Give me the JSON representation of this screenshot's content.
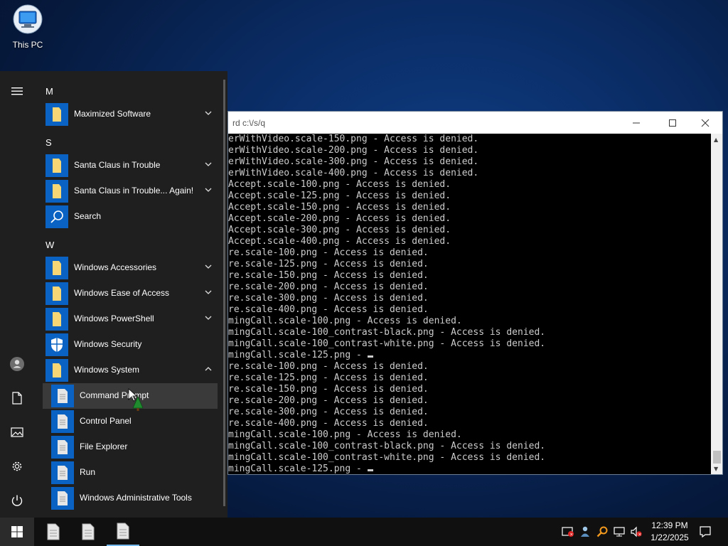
{
  "desktop": {
    "icons": [
      {
        "label": "This PC",
        "icon": "this-pc-icon"
      }
    ]
  },
  "console": {
    "title": "rd  c:\\/s/q",
    "lines": [
      "erWithVideo.scale-150.png - Access is denied.",
      "erWithVideo.scale-200.png - Access is denied.",
      "erWithVideo.scale-300.png - Access is denied.",
      "erWithVideo.scale-400.png - Access is denied.",
      "Accept.scale-100.png - Access is denied.",
      "Accept.scale-125.png - Access is denied.",
      "Accept.scale-150.png - Access is denied.",
      "Accept.scale-200.png - Access is denied.",
      "Accept.scale-300.png - Access is denied.",
      "Accept.scale-400.png - Access is denied.",
      "re.scale-100.png - Access is denied.",
      "re.scale-125.png - Access is denied.",
      "re.scale-150.png - Access is denied.",
      "re.scale-200.png - Access is denied.",
      "re.scale-300.png - Access is denied.",
      "re.scale-400.png - Access is denied.",
      "mingCall.scale-100.png - Access is denied.",
      "mingCall.scale-100_contrast-black.png - Access is denied.",
      "mingCall.scale-100_contrast-white.png - Access is denied.",
      "mingCall.scale-125.png - ",
      "re.scale-100.png - Access is denied.",
      "re.scale-125.png - Access is denied.",
      "re.scale-150.png - Access is denied.",
      "re.scale-200.png - Access is denied.",
      "re.scale-300.png - Access is denied.",
      "re.scale-400.png - Access is denied.",
      "mingCall.scale-100.png - Access is denied.",
      "mingCall.scale-100_contrast-black.png - Access is denied.",
      "mingCall.scale-100_contrast-white.png - Access is denied.",
      "mingCall.scale-125.png - "
    ],
    "cursor_lines": [
      19,
      29
    ]
  },
  "start_menu": {
    "groups": [
      {
        "letter": "M",
        "apps": [
          {
            "name": "Maximized Software",
            "icon": "folder-icon",
            "expandable": true,
            "expanded": false
          }
        ]
      },
      {
        "letter": "S",
        "apps": [
          {
            "name": "Santa Claus in Trouble",
            "icon": "folder-icon",
            "expandable": true,
            "expanded": false
          },
          {
            "name": "Santa Claus in Trouble... Again!",
            "icon": "folder-icon",
            "expandable": true,
            "expanded": false
          },
          {
            "name": "Search",
            "icon": "search-icon",
            "expandable": false
          }
        ]
      },
      {
        "letter": "W",
        "apps": [
          {
            "name": "Windows Accessories",
            "icon": "folder-icon",
            "expandable": true,
            "expanded": false
          },
          {
            "name": "Windows Ease of Access",
            "icon": "folder-icon",
            "expandable": true,
            "expanded": false
          },
          {
            "name": "Windows PowerShell",
            "icon": "folder-icon",
            "expandable": true,
            "expanded": false
          },
          {
            "name": "Windows Security",
            "icon": "shield-icon",
            "expandable": false
          },
          {
            "name": "Windows System",
            "icon": "folder-icon",
            "expandable": true,
            "expanded": true
          }
        ]
      }
    ],
    "subitems": [
      {
        "name": "Command Prompt",
        "icon": "document-icon",
        "highlighted": true
      },
      {
        "name": "Control Panel",
        "icon": "document-icon"
      },
      {
        "name": "File Explorer",
        "icon": "document-icon"
      },
      {
        "name": "Run",
        "icon": "document-icon"
      },
      {
        "name": "Windows Administrative Tools",
        "icon": "document-icon"
      }
    ],
    "rail": [
      "hamburger-icon",
      "user-icon",
      "documents-icon",
      "pictures-icon",
      "settings-icon",
      "power-icon"
    ]
  },
  "taskbar": {
    "apps": [
      {
        "icon": "document-icon"
      },
      {
        "icon": "document-icon"
      },
      {
        "icon": "document-icon",
        "active": true
      }
    ],
    "tray": [
      "security-alert-icon",
      "people-icon",
      "search-tool-icon",
      "network-icon",
      "volume-muted-icon"
    ],
    "time": "12:39 PM",
    "date": "1/22/2025"
  },
  "colors": {
    "accent": "#0a63c2",
    "highlight": "#3a3a3a",
    "menu_bg": "#1f1f1f",
    "console_text": "#cccccc"
  }
}
